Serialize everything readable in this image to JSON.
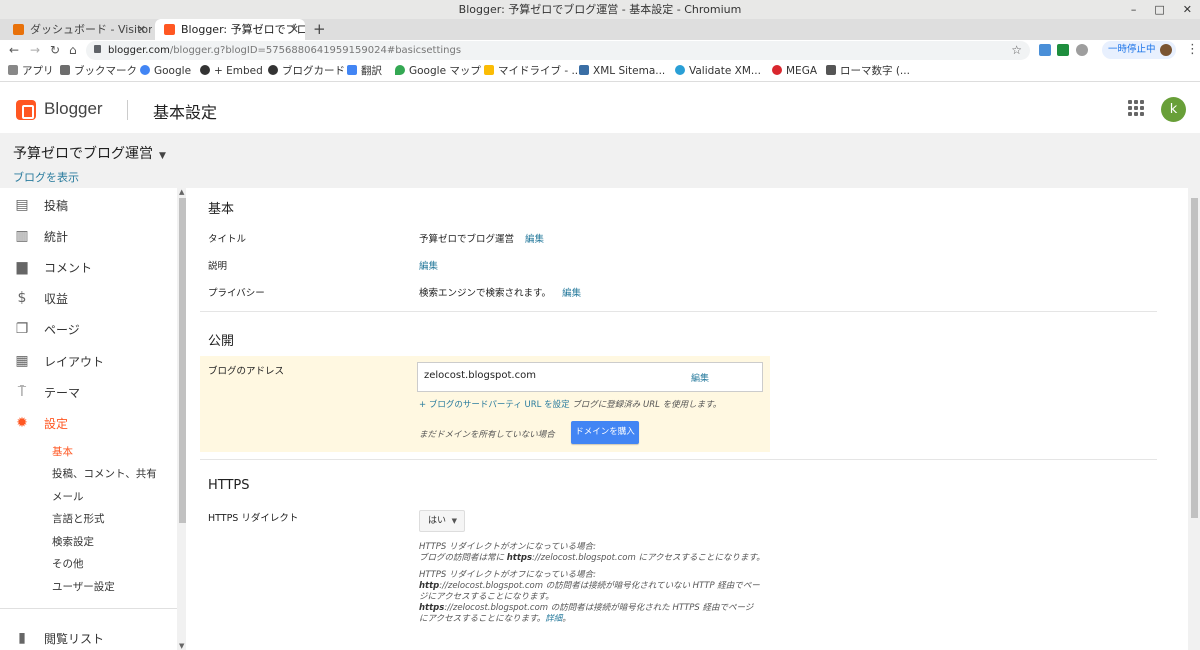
{
  "window": {
    "title": "Blogger: 予算ゼロでブログ運営 - 基本設定 - Chromium",
    "controls": [
      "–",
      "□",
      "✕"
    ]
  },
  "tabs": [
    {
      "title": "ダッシュボード - Visitors",
      "favicon_color": "#e8710a"
    },
    {
      "title": "Blogger: 予算ゼロでブロ",
      "favicon_color": "#ff5722"
    }
  ],
  "newtab_label": "+",
  "address": {
    "url_host": "blogger.com",
    "url_path": "/blogger.g?blogID=5756880641959159024#basicsettings",
    "pause_label": "一時停止中"
  },
  "bookmarks": [
    {
      "label": "アプリ",
      "color": "#888"
    },
    {
      "label": "ブックマーク",
      "color": "#6d6d6d"
    },
    {
      "label": "Google",
      "color": "#4285f4"
    },
    {
      "label": "+ Embed",
      "color": "#333"
    },
    {
      "label": "ブログカード",
      "color": "#333"
    },
    {
      "label": "翻訳",
      "color": "#4285f4"
    },
    {
      "label": "Google マップ",
      "color": "#34a853"
    },
    {
      "label": "マイドライブ - ...",
      "color": "#fbbc05"
    },
    {
      "label": "XML Sitema...",
      "color": "#3a6ea5"
    },
    {
      "label": "Validate XM...",
      "color": "#2a9fd6"
    },
    {
      "label": "MEGA",
      "color": "#d9272e"
    },
    {
      "label": "ローマ数字 (...",
      "color": "#555"
    }
  ],
  "header": {
    "product": "Blogger",
    "page_title": "基本設定",
    "avatar_letter": "k"
  },
  "blog": {
    "title": "予算ゼロでブログ運営",
    "view_link": "ブログを表示"
  },
  "sidebar": {
    "items": [
      {
        "label": "投稿",
        "icon": "posts-icon",
        "glyph": "▤"
      },
      {
        "label": "統計",
        "icon": "stats-icon",
        "glyph": "▥"
      },
      {
        "label": "コメント",
        "icon": "comments-icon",
        "glyph": "▆"
      },
      {
        "label": "収益",
        "icon": "earnings-icon",
        "glyph": "$"
      },
      {
        "label": "ページ",
        "icon": "pages-icon",
        "glyph": "❐"
      },
      {
        "label": "レイアウト",
        "icon": "layout-icon",
        "glyph": "▦"
      },
      {
        "label": "テーマ",
        "icon": "theme-icon",
        "glyph": "⍑"
      },
      {
        "label": "設定",
        "icon": "settings-icon",
        "glyph": "✹"
      }
    ],
    "sub_items": [
      "基本",
      "投稿、コメント、共有",
      "メール",
      "言語と形式",
      "検索設定",
      "その他",
      "ユーザー設定"
    ],
    "reading_list": {
      "label": "閲覧リスト",
      "glyph": "▮"
    }
  },
  "basic": {
    "heading": "基本",
    "title_label": "タイトル",
    "title_value": "予算ゼロでブログ運営",
    "edit": "編集",
    "desc_label": "説明",
    "privacy_label": "プライバシー",
    "privacy_value": "検索エンジンで検索されます。"
  },
  "publish": {
    "heading": "公開",
    "address_label": "ブログのアドレス",
    "address_value": "zelocost.blogspot.com",
    "third_party_link": "+ ブログのサードパーティ URL を設定",
    "third_party_rest": "ブログに登録済み URL を使用します。",
    "no_domain_text": "まだドメインを所有していない場合",
    "buy_domain_button": "ドメインを購入"
  },
  "https": {
    "heading": "HTTPS",
    "redirect_label": "HTTPS リダイレクト",
    "select_value": "はい",
    "on_line1": "HTTPS リダイレクトがオンになっている場合:",
    "on_line2_pre": "ブログの訪問者は常に ",
    "on_line2_bold": "https",
    "on_line2_post": "://zelocost.blogspot.com にアクセスすることになります。",
    "off_line1": "HTTPS リダイレクトがオフになっている場合:",
    "off_line2_bold": "http",
    "off_line2_post": "://zelocost.blogspot.com の訪問者は接続が暗号化されていない HTTP 経由でペー",
    "off_line3": "ジにアクセスすることになります。",
    "off_line4_bold": "https",
    "off_line4_post": "://zelocost.blogspot.com の訪問者は接続が暗号化された HTTPS 経由でページ",
    "off_line5": "にアクセスすることになります。",
    "details_link": "詳細"
  }
}
